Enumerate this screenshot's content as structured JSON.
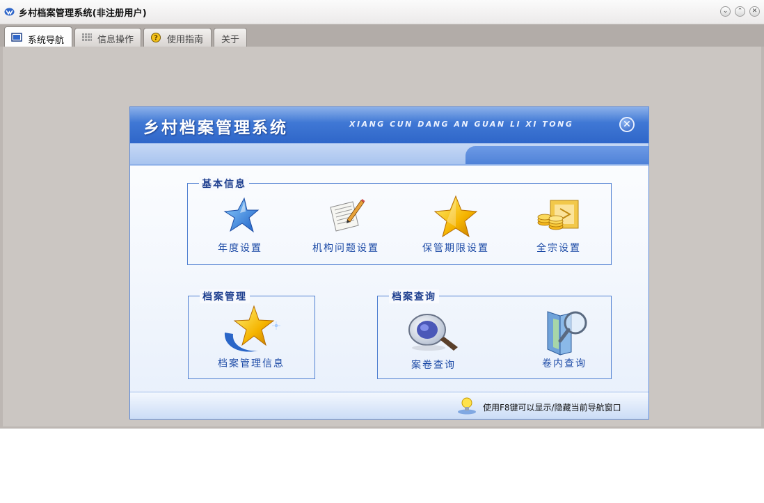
{
  "window": {
    "title": "乡村档案管理系统(非注册用户)"
  },
  "window_controls": [
    "minimize",
    "maximize",
    "close"
  ],
  "tabs": [
    {
      "label": "系统导航",
      "icon": "monitor-icon",
      "active": true
    },
    {
      "label": "信息操作",
      "icon": "grid-icon",
      "active": false
    },
    {
      "label": "使用指南",
      "icon": "help-icon",
      "active": false
    },
    {
      "label": "关于",
      "icon": "",
      "active": false
    }
  ],
  "panel": {
    "title": "乡村档案管理系统",
    "subtitle": "XIANG CUN DANG AN GUAN LI XI TONG",
    "hint": "使用F8键可以显示/隐藏当前导航窗口"
  },
  "groups": {
    "basic": {
      "legend": "基本信息",
      "items": [
        {
          "label": "年度设置",
          "icon": "blue-star-icon"
        },
        {
          "label": "机构问题设置",
          "icon": "document-pencil-icon"
        },
        {
          "label": "保管期限设置",
          "icon": "gold-star-icon"
        },
        {
          "label": "全宗设置",
          "icon": "coins-folder-icon"
        }
      ]
    },
    "archive": {
      "legend": "档案管理",
      "items": [
        {
          "label": "档案管理信息",
          "icon": "star-swirl-icon"
        }
      ]
    },
    "query": {
      "legend": "档案查询",
      "items": [
        {
          "label": "案卷查询",
          "icon": "magnifier-icon"
        },
        {
          "label": "卷内查询",
          "icon": "folder-search-icon"
        }
      ]
    }
  },
  "colors": {
    "accent": "#2f66c9",
    "label": "#1c4aa6",
    "workspace": "#cbc6c2"
  }
}
